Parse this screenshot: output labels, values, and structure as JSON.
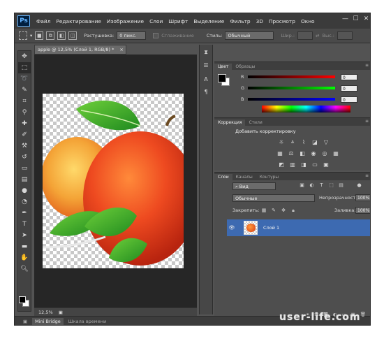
{
  "app": {
    "logo": "Ps",
    "menu": [
      "Файл",
      "Редактирование",
      "Изображение",
      "Слои",
      "Шрифт",
      "Выделение",
      "Фильтр",
      "3D",
      "Просмотр",
      "Окно"
    ],
    "window_controls": [
      "—",
      "☐",
      "✕"
    ]
  },
  "options_bar": {
    "feather_label": "Растушевка:",
    "feather_value": "0 пикс.",
    "antialias_label": "Сглаживание",
    "style_label": "Стиль:",
    "style_value": "Обычный",
    "width_label": "Шир.:",
    "height_label": "Выс.:"
  },
  "document": {
    "tab_title": "apple @ 12,5% (Слой 1, RGB/8) *",
    "tab_close": "×",
    "zoom": "12,5%"
  },
  "bottom_tabs": [
    "Mini Bridge",
    "Шкала времени"
  ],
  "color_panel": {
    "tabs": [
      "Цвет",
      "Образцы"
    ],
    "channels": [
      {
        "label": "R",
        "value": "0",
        "gradient": "#ff0000"
      },
      {
        "label": "G",
        "value": "0",
        "gradient": "#00ff00"
      },
      {
        "label": "B",
        "value": "0",
        "gradient": "#0000ff"
      }
    ],
    "foreground": "#000000",
    "background": "#ffffff"
  },
  "adjustments_panel": {
    "tabs": [
      "Коррекция",
      "Стили"
    ],
    "title": "Добавить корректировку"
  },
  "layers_panel": {
    "tabs": [
      "Слои",
      "Каналы",
      "Контуры"
    ],
    "filter_value": "Вид",
    "blend_mode": "Обычные",
    "opacity_label": "Непрозрачность:",
    "opacity_value": "100%",
    "lock_label": "Закрепить:",
    "fill_label": "Заливка:",
    "fill_value": "100%",
    "layer_name": "Слой 1",
    "selected_color": "#3d6ab1"
  },
  "watermark": "user-life.com"
}
